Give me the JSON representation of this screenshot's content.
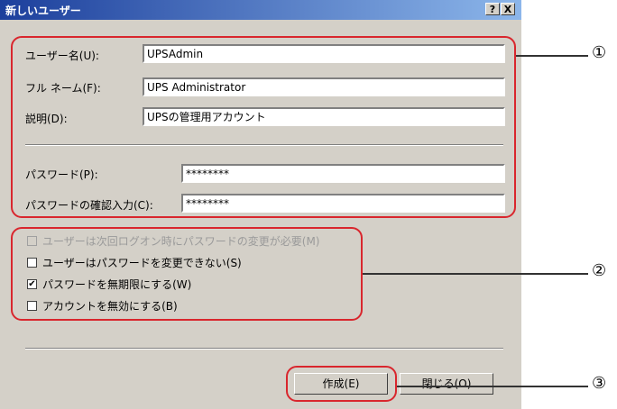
{
  "window": {
    "title": "新しいユーザー",
    "help_glyph": "?",
    "close_glyph": "X"
  },
  "form": {
    "username": {
      "label": "ユーザー名(U):",
      "value": "UPSAdmin"
    },
    "fullname": {
      "label": "フル ネーム(F):",
      "value": "UPS Administrator"
    },
    "description": {
      "label": "説明(D):",
      "value": "UPSの管理用アカウント"
    },
    "password": {
      "label": "パスワード(P):",
      "value": "********"
    },
    "password_confirm": {
      "label": "パスワードの確認入力(C):",
      "value": "********"
    }
  },
  "options": [
    {
      "label": "ユーザーは次回ログオン時にパスワードの変更が必要(M)",
      "checked": false,
      "disabled": true
    },
    {
      "label": "ユーザーはパスワードを変更できない(S)",
      "checked": false,
      "disabled": false
    },
    {
      "label": "パスワードを無期限にする(W)",
      "checked": true,
      "disabled": false
    },
    {
      "label": "アカウントを無効にする(B)",
      "checked": false,
      "disabled": false
    }
  ],
  "buttons": {
    "create": "作成(E)",
    "close": "閉じる(O)"
  },
  "callouts": [
    "①",
    "②",
    "③"
  ],
  "colors": {
    "title_start": "#1c3f9c",
    "title_end": "#8cb6ea",
    "dialog_bg": "#d4d0c8",
    "annotation_red": "#d9262d"
  }
}
